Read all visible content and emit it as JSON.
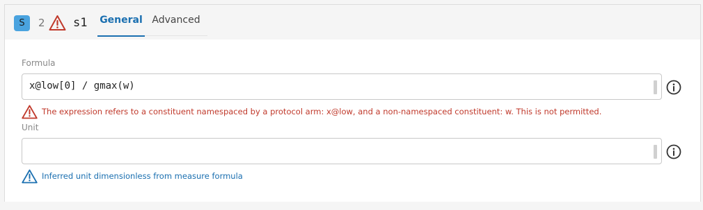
{
  "header": {
    "badge_letter": "S",
    "warning_count": "2",
    "item_name": "s1",
    "tabs": [
      {
        "label": "General",
        "active": true
      },
      {
        "label": "Advanced",
        "active": false
      }
    ]
  },
  "formula": {
    "label": "Formula",
    "value": "x@low[0] / gmax(w)",
    "error": "The expression refers to a constituent namespaced by a protocol arm: x@low, and a non-namespaced constituent: w. This is not permitted."
  },
  "unit": {
    "label": "Unit",
    "value": "",
    "info": "Inferred unit dimensionless from measure formula"
  },
  "colors": {
    "accent": "#1a6fb0",
    "badge": "#4aa3df",
    "error": "#c0392b"
  },
  "icons": {
    "warning": "warning-triangle-icon",
    "info": "info-circle-icon"
  }
}
